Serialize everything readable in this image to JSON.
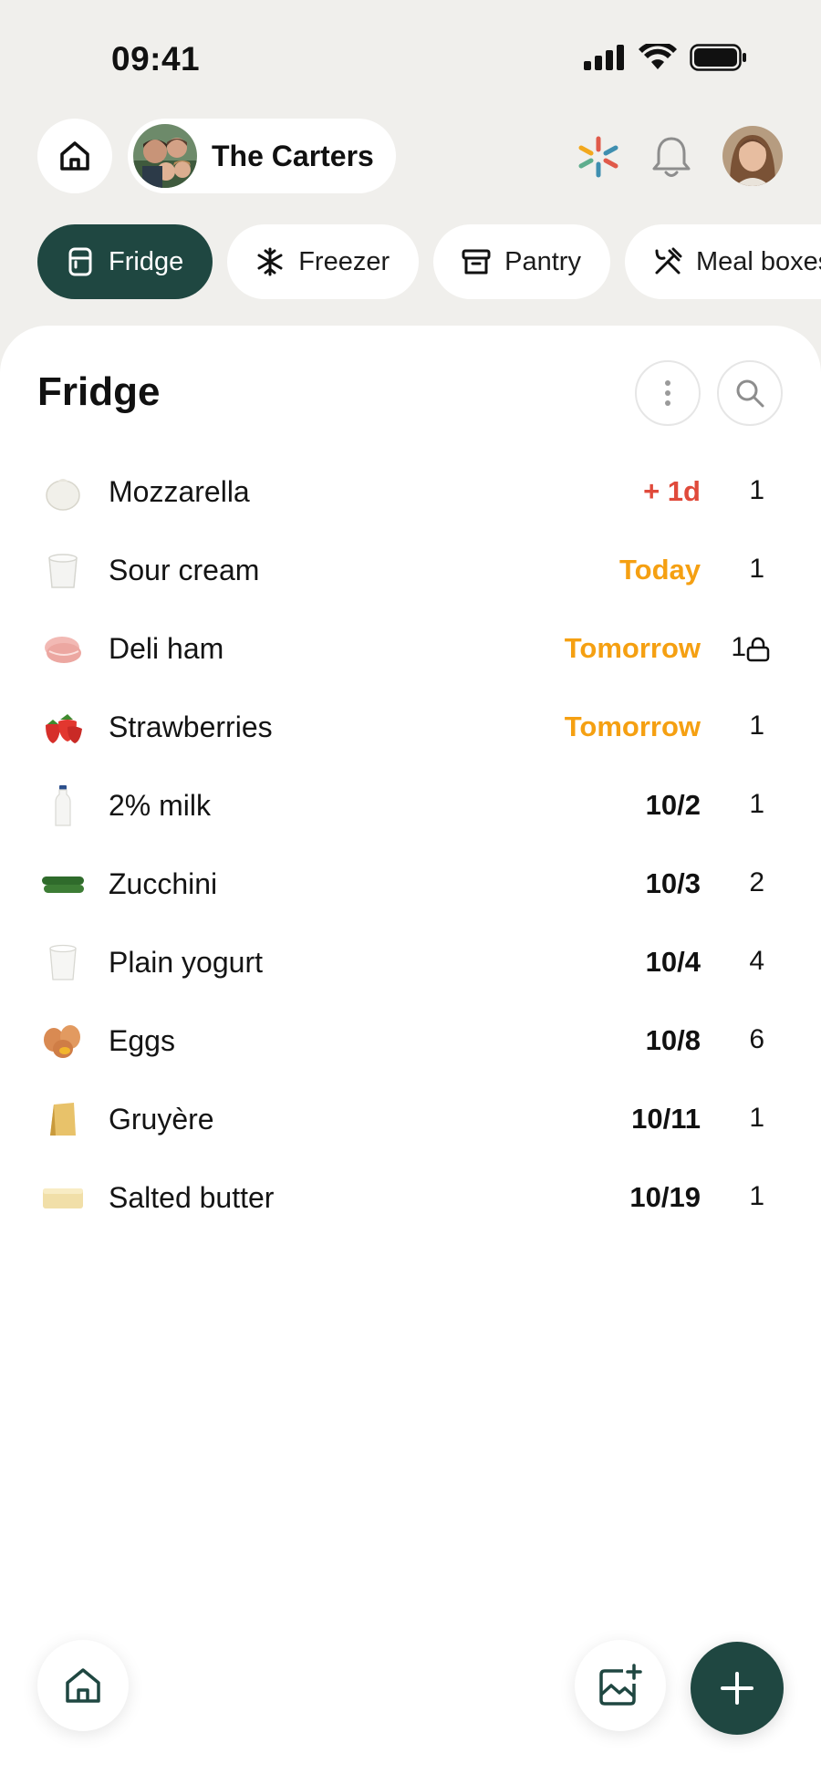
{
  "status_bar": {
    "time": "09:41"
  },
  "header": {
    "household_name": "The Carters",
    "icons": [
      "home-icon",
      "sparkle-icon",
      "bell-icon"
    ]
  },
  "tabs": [
    {
      "label": "Fridge",
      "icon": "fridge-icon",
      "active": true
    },
    {
      "label": "Freezer",
      "icon": "snowflake-icon",
      "active": false
    },
    {
      "label": "Pantry",
      "icon": "archive-box-icon",
      "active": false
    },
    {
      "label": "Meal boxes",
      "icon": "utensils-crossed-icon",
      "active": false
    }
  ],
  "sheet": {
    "title": "Fridge"
  },
  "items": [
    {
      "name": "Mozzarella",
      "expiry": "+ 1d",
      "status": "overdue",
      "qty": "1",
      "locked": false
    },
    {
      "name": "Sour cream",
      "expiry": "Today",
      "status": "soon",
      "qty": "1",
      "locked": false
    },
    {
      "name": "Deli ham",
      "expiry": "Tomorrow",
      "status": "soon",
      "qty": "1",
      "locked": true
    },
    {
      "name": "Strawberries",
      "expiry": "Tomorrow",
      "status": "soon",
      "qty": "1",
      "locked": false
    },
    {
      "name": "2% milk",
      "expiry": "10/2",
      "status": "normal",
      "qty": "1",
      "locked": false
    },
    {
      "name": "Zucchini",
      "expiry": "10/3",
      "status": "normal",
      "qty": "2",
      "locked": false
    },
    {
      "name": "Plain yogurt",
      "expiry": "10/4",
      "status": "normal",
      "qty": "4",
      "locked": false
    },
    {
      "name": "Eggs",
      "expiry": "10/8",
      "status": "normal",
      "qty": "6",
      "locked": false
    },
    {
      "name": "Gruyère",
      "expiry": "10/11",
      "status": "normal",
      "qty": "1",
      "locked": false
    },
    {
      "name": "Salted butter",
      "expiry": "10/19",
      "status": "normal",
      "qty": "1",
      "locked": false
    }
  ],
  "colors": {
    "accent": "#1f4741",
    "overdue": "#e04a3b",
    "soon": "#f5a012",
    "background": "#f0efec"
  }
}
